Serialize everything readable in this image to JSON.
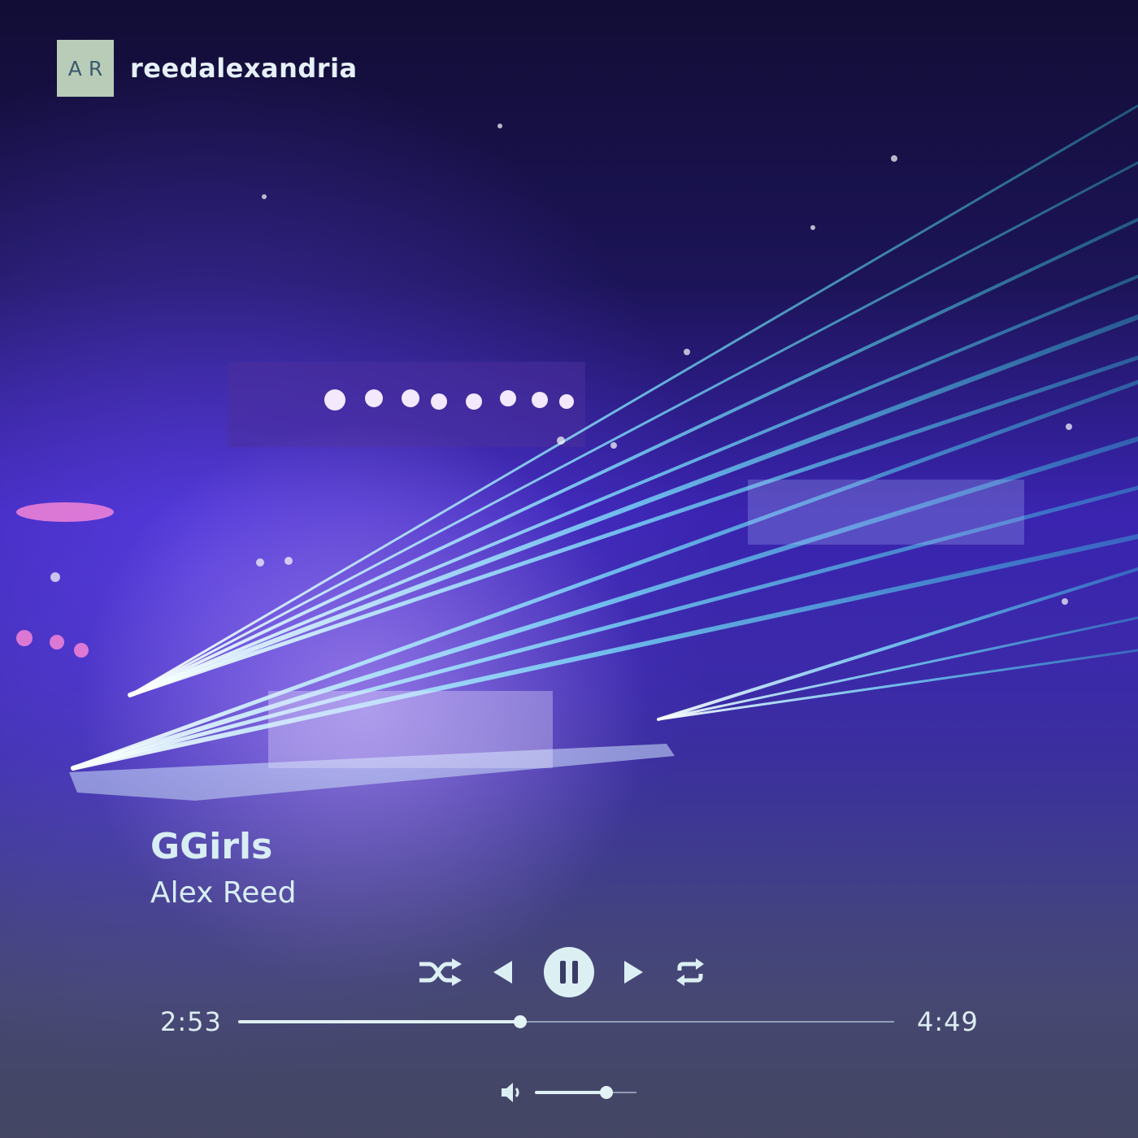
{
  "brand": {
    "logo_text": "AR",
    "handle": "reedalexandria"
  },
  "track": {
    "title": "GGirls",
    "artist": "Alex Reed"
  },
  "player": {
    "state": "playing",
    "controls": [
      "shuffle-icon",
      "previous-icon",
      "pause-icon",
      "next-icon",
      "repeat-icon"
    ],
    "elapsed": "2:53",
    "duration": "4:49",
    "progress_fraction": 0.43,
    "volume_fraction": 0.7
  },
  "colors": {
    "accent": "#dff0f4",
    "logo_bg": "#b9ccb7",
    "logo_text": "#3b5a6e"
  }
}
